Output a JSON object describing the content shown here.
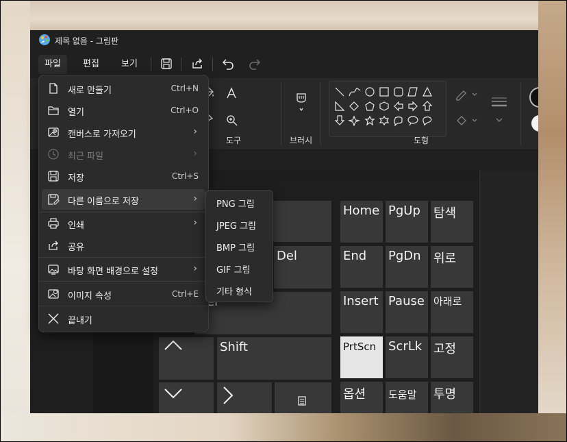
{
  "window": {
    "title": "제목 없음 - 그림판"
  },
  "menubar": {
    "tabs": [
      {
        "label": "파일"
      },
      {
        "label": "편집"
      },
      {
        "label": "보기"
      }
    ]
  },
  "ribbon": {
    "groups": {
      "tools": "도구",
      "brush": "브러시",
      "shapes": "도형"
    }
  },
  "file_menu": {
    "items": [
      {
        "label": "새로 만들기",
        "shortcut": "Ctrl+N",
        "icon": "new-file-icon"
      },
      {
        "label": "열기",
        "shortcut": "Ctrl+O",
        "icon": "folder-icon"
      },
      {
        "label": "캔버스로 가져오기",
        "icon": "import-image-icon",
        "submenu": true
      },
      {
        "label": "최근 파일",
        "icon": "clock-icon",
        "submenu": true,
        "disabled": true
      },
      {
        "label": "저장",
        "shortcut": "Ctrl+S",
        "icon": "save-icon"
      },
      {
        "label": "다른 이름으로 저장",
        "icon": "save-as-icon",
        "submenu": true,
        "highlighted": true
      },
      {
        "label": "인쇄",
        "icon": "printer-icon",
        "submenu": true
      },
      {
        "label": "공유",
        "icon": "share-icon"
      },
      {
        "label": "바탕 화면 배경으로 설정",
        "icon": "wallpaper-icon",
        "submenu": true
      },
      {
        "label": "이미지 속성",
        "shortcut": "Ctrl+E",
        "icon": "image-properties-icon"
      },
      {
        "label": "끝내기",
        "icon": "close-icon"
      }
    ]
  },
  "save_as_submenu": {
    "items": [
      {
        "label": "PNG 그림"
      },
      {
        "label": "JPEG 그림"
      },
      {
        "label": "BMP 그림"
      },
      {
        "label": "GIF 그림"
      },
      {
        "label": "기타 형식"
      }
    ]
  },
  "canvas": {
    "keys": {
      "home": "Home",
      "pgup": "PgUp",
      "search": "탐색",
      "del": "Del",
      "end": "End",
      "pgdn": "PgDn",
      "up": "위로",
      "enter_partial": "er",
      "insert": "Insert",
      "pause": "Pause",
      "down": "아래로",
      "shift": "Shift",
      "prtscn": "PrtScn",
      "scrlk": "ScrLk",
      "pin": "고정",
      "options": "옵션",
      "help": "도움말",
      "transparent": "투명"
    }
  },
  "colors": {
    "window_bg": "#202020",
    "ribbon_bg": "#282828",
    "menu_bg": "#2b2b2b",
    "key_bg": "#383838",
    "key_highlight": "#e6e6e6"
  }
}
